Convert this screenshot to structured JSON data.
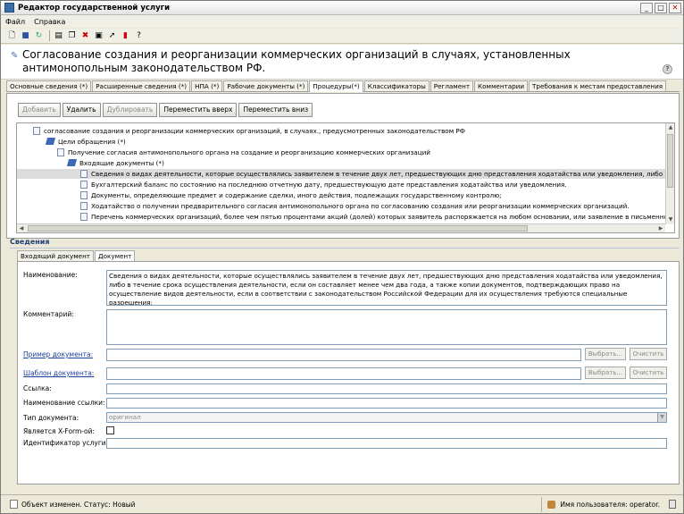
{
  "window": {
    "title": "Редактор государственной услуги"
  },
  "menu": [
    "Файл",
    "Справка"
  ],
  "toolbar_icons": [
    "new-doc-icon",
    "save-icon",
    "refresh-icon",
    "doc-icon",
    "copy-icon",
    "delete-icon",
    "open-icon",
    "cursor-icon",
    "pdf-icon",
    "help-icon"
  ],
  "header": {
    "title": "Согласование создания и реорганизации коммерческих организаций в случаях, установленных антимонопольным законодательством РФ."
  },
  "tabs": [
    {
      "label": "Основные сведения (*)"
    },
    {
      "label": "Расширенные сведения (*)"
    },
    {
      "label": "НПА (*)"
    },
    {
      "label": "Рабочие документы (*)"
    },
    {
      "label": "Процедуры(*)"
    },
    {
      "label": "Классификаторы"
    },
    {
      "label": "Регламент"
    },
    {
      "label": "Комментарии"
    },
    {
      "label": "Требования к местам предоставления"
    }
  ],
  "proc_buttons": {
    "add": "Добавить",
    "delete": "Удалить",
    "duplicate": "Дублировать",
    "move_up": "Переместить вверх",
    "move_down": "Переместить вниз"
  },
  "tree": {
    "items": [
      "согласование создания и реорганизации коммерческих организаций, в случаях., предусмотренных законодательством РФ",
      "Цели обращения (*)",
      "Получение согласия  антимонопольного органа на  создание и реорганизацию коммерческих организаций",
      "Входящие документы (*)",
      "Сведения о видах деятельности, которые осуществлялись заявителем в течение двух лет, предшествующих дню представления ходатайства или уведомления, либо в течение срока",
      "Бухгалтерский баланс по состоянию на последнюю отчетную дату, предшествующую дате представления ходатайства или уведомления.",
      "Документы, определяющие предмет и содержание сделки, иного действия, подлежащих государственному контролю;",
      "Ходатайство о получении предварительного согласия антимонопольного органа по согласованию создания или реорганизации коммерческих организаций.",
      "Перечень коммерческих организаций, более чем пятью процентами акций (долей) которых заявитель распоряжается на любом основании, или заявление в письменной форме о том"
    ]
  },
  "details": {
    "header": "Сведения",
    "subtabs": [
      "Входящий документ",
      "Документ"
    ]
  },
  "form": {
    "name_label": "Наименование:",
    "name_value": "Сведения о видах деятельности, которые осуществлялись заявителем в течение двух лет, предшествующих дню представления ходатайства или уведомления, либо в течение срока осуществления деятельности, если он составляет менее чем два года, а также копии документов, подтверждающих право на осуществление видов деятельности, если в соответствии с законодательством Российской Федерации для их осуществления требуются специальные разрешения;",
    "comment_label": "Комментарий:",
    "example_label": "Пример документа:",
    "template_label": "Шаблон документа:",
    "link_label": "Ссылка:",
    "link_name_label": "Наименование ссылки:",
    "doc_type_label": "Тип документа:",
    "doc_type_value": "оригинал",
    "xform_label": "Является X-Form-ой:",
    "service_id_label": "Идентификатор услуги:",
    "choose_label": "Выбрать...",
    "clear_label": "Очистить"
  },
  "status": {
    "left": "Объект изменен. Статус: Новый",
    "user": "Имя пользователя: operator."
  }
}
